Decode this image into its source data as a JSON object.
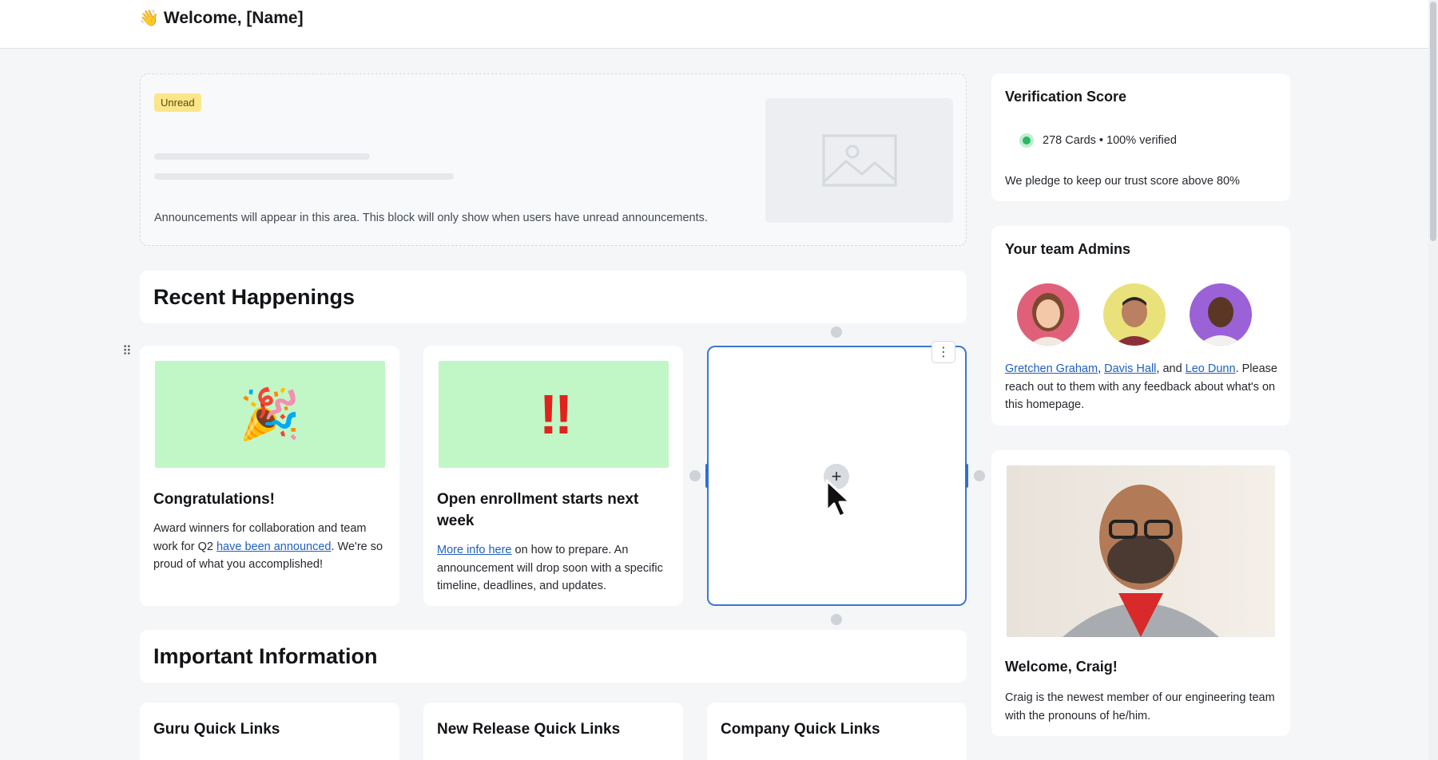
{
  "header": {
    "title": "Welcome, [Name]",
    "wave_icon": "👋"
  },
  "announcement": {
    "badge": "Unread",
    "note": "Announcements will appear in this area. This block will only show when users have unread announcements."
  },
  "recent": {
    "title": "Recent Happenings",
    "cards": [
      {
        "emoji": "🎉",
        "title": "Congratulations!",
        "body_before": "Award winners for collaboration and team work for Q2 ",
        "link": "have been announced",
        "body_after": ".  We're so proud of what you accomplished!"
      },
      {
        "emoji": "‼",
        "title": "Open enrollment starts next week",
        "link": "More info here",
        "body_after": " on how to prepare. An announcement will drop soon with a specific timeline, deadlines, and updates."
      }
    ],
    "add_label": "+",
    "menu_label": "⋮"
  },
  "important": {
    "title": "Important Information",
    "cards": [
      "Guru Quick Links",
      "New Release Quick Links",
      "Company Quick Links"
    ]
  },
  "verification": {
    "title": "Verification Score",
    "status": "278 Cards • 100% verified",
    "pledge": "We pledge to keep our trust score above 80%",
    "status_color": "#29b766"
  },
  "admins": {
    "title": "Your team Admins",
    "names": [
      "Gretchen Graham",
      "Davis Hall",
      "Leo Dunn"
    ],
    "sep1": ", ",
    "sep2": ", and ",
    "tail": ". Please reach out to them with any feedback about what's on this homepage.",
    "avatar_colors": [
      "#e0607a",
      "#e9e27a",
      "#9a62d6"
    ]
  },
  "welcome": {
    "title": "Welcome, Craig!",
    "body": "Craig is the newest member of our engineering team with the pronouns of he/him."
  }
}
